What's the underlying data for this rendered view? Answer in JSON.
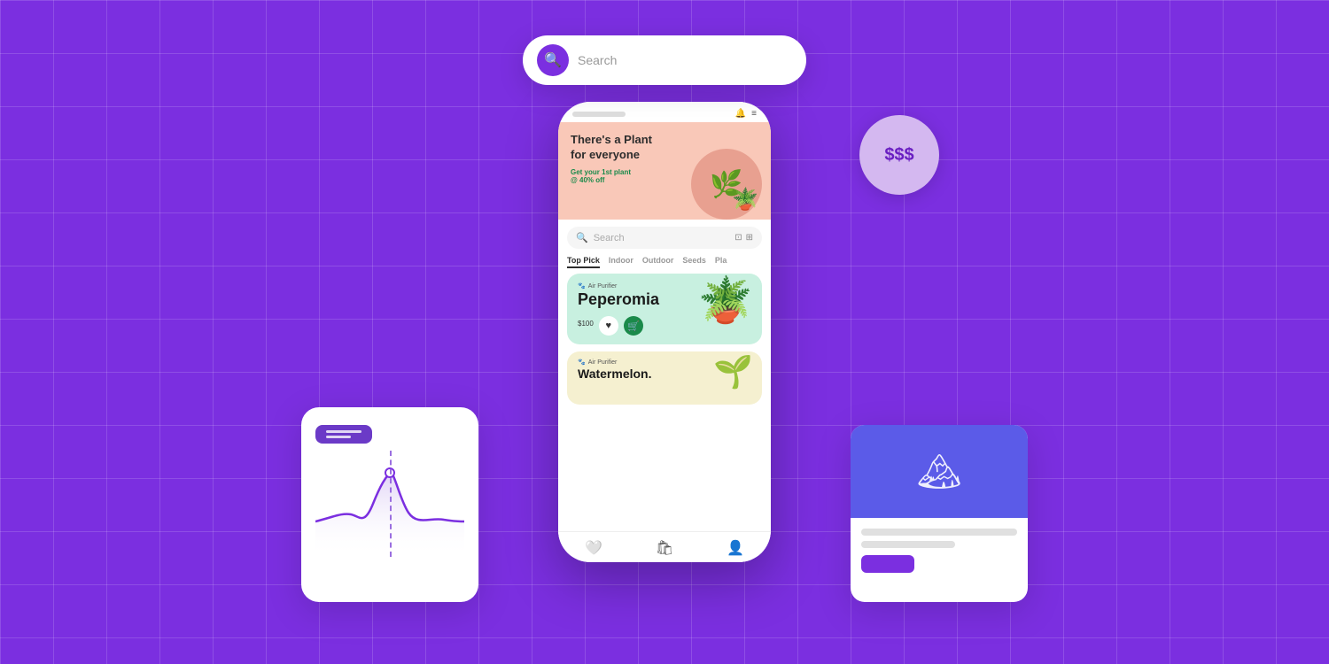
{
  "background": {
    "color": "#7B2FE0",
    "grid_color": "rgba(255,255,255,0.15)"
  },
  "floating_search": {
    "placeholder": "Search",
    "icon": "search"
  },
  "money_badge": {
    "text": "$$$"
  },
  "phone": {
    "status": {
      "notch": true,
      "bell_icon": "bell",
      "menu_icon": "menu"
    },
    "hero": {
      "title": "There's a Plant for everyone",
      "promo_text": "Get your 1st plant",
      "promo_discount": "@ 40% off"
    },
    "search": {
      "placeholder": "Search",
      "has_scan": true,
      "has_filter": true
    },
    "categories": [
      {
        "label": "Top Pick",
        "active": true
      },
      {
        "label": "Indoor",
        "active": false
      },
      {
        "label": "Outdoor",
        "active": false
      },
      {
        "label": "Seeds",
        "active": false
      },
      {
        "label": "Pla...",
        "active": false
      }
    ],
    "products": [
      {
        "category_label": "Air Purifier",
        "name": "Peperomia",
        "price": "$100",
        "has_heart": true,
        "has_cart": true
      },
      {
        "category_label": "Air Purifier",
        "name": "Watermelon...",
        "price": "",
        "has_heart": false,
        "has_cart": false
      }
    ],
    "bottom_nav": [
      {
        "icon": "heart",
        "label": "wishlist"
      },
      {
        "icon": "shop",
        "label": "shop"
      },
      {
        "icon": "user",
        "label": "profile"
      }
    ]
  },
  "chart_card": {
    "tooltip_lines": 2
  },
  "image_card": {
    "has_image": true,
    "button_label": ""
  }
}
